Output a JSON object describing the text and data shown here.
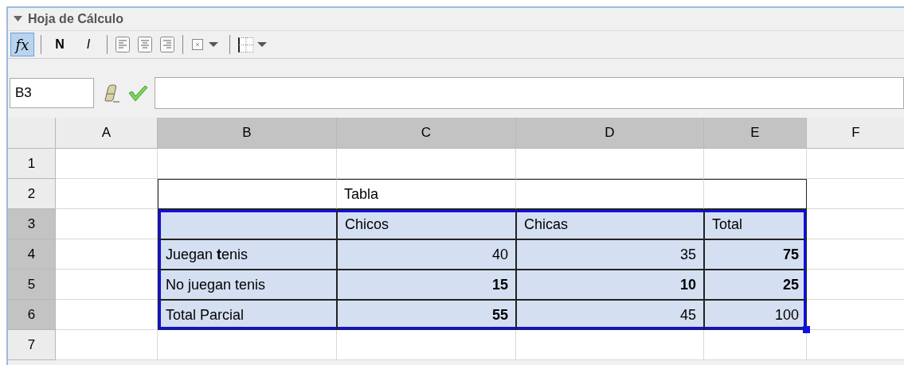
{
  "panel": {
    "title": "Hoja de Cálculo"
  },
  "toolbar": [
    {
      "kind": "formula",
      "label": "fx",
      "selected": true
    },
    {
      "kind": "sep"
    },
    {
      "kind": "bold",
      "label": "N",
      "selected": false
    },
    {
      "kind": "italic",
      "label": "I",
      "selected": false
    },
    {
      "kind": "sep"
    },
    {
      "kind": "align-left",
      "selected": false
    },
    {
      "kind": "align-center",
      "selected": false
    },
    {
      "kind": "align-right",
      "selected": false
    },
    {
      "kind": "sep"
    },
    {
      "kind": "border-menu"
    },
    {
      "kind": "sep"
    },
    {
      "kind": "grid-menu"
    }
  ],
  "formula_bar": {
    "cell_name": "B3"
  },
  "columns": [
    {
      "label": "A",
      "selected": false
    },
    {
      "label": "B",
      "selected": true
    },
    {
      "label": "C",
      "selected": true
    },
    {
      "label": "D",
      "selected": true
    },
    {
      "label": "E",
      "selected": true
    },
    {
      "label": "F",
      "selected": false
    }
  ],
  "rows": [
    {
      "label": "1",
      "selected": false,
      "cells": [
        {
          "selected": false,
          "outlined": false,
          "boxed": false
        },
        {
          "selected": false,
          "outlined": false,
          "boxed": false
        },
        {
          "selected": false,
          "outlined": false,
          "boxed": false
        },
        {
          "selected": false,
          "outlined": false,
          "boxed": false
        },
        {
          "selected": false,
          "outlined": false,
          "boxed": false
        },
        {
          "selected": false,
          "outlined": false,
          "boxed": false
        }
      ]
    },
    {
      "label": "2",
      "selected": false,
      "cells": [
        {
          "selected": false,
          "outlined": false,
          "boxed": false
        },
        {
          "selected": false,
          "outlined": true,
          "boxed": false
        },
        {
          "text": "Tabla",
          "bold": false,
          "numeric": false,
          "selected": false,
          "outlined": true,
          "boxed": false
        },
        {
          "selected": false,
          "outlined": true,
          "boxed": false
        },
        {
          "selected": false,
          "outlined": true,
          "boxed": false
        },
        {
          "selected": false,
          "outlined": false,
          "boxed": false
        }
      ]
    },
    {
      "label": "3",
      "selected": true,
      "cells": [
        {
          "selected": false,
          "outlined": false,
          "boxed": false
        },
        {
          "selected": true,
          "outlined": false,
          "boxed": true
        },
        {
          "text": "Chicos",
          "bold": false,
          "numeric": false,
          "selected": true,
          "outlined": false,
          "boxed": true
        },
        {
          "text": "Chicas",
          "bold": false,
          "numeric": false,
          "selected": true,
          "outlined": false,
          "boxed": true
        },
        {
          "text": "Total",
          "bold": false,
          "numeric": false,
          "selected": true,
          "outlined": false,
          "boxed": true
        },
        {
          "selected": false,
          "outlined": false,
          "boxed": false
        }
      ]
    },
    {
      "label": "4",
      "selected": true,
      "cells": [
        {
          "selected": false,
          "outlined": false,
          "boxed": false
        },
        {
          "text": "Juegan **t**enis",
          "bold": false,
          "numeric": false,
          "selected": true,
          "outlined": false,
          "boxed": true
        },
        {
          "text": "40",
          "bold": false,
          "numeric": true,
          "selected": true,
          "outlined": false,
          "boxed": true
        },
        {
          "text": "35",
          "bold": false,
          "numeric": true,
          "selected": true,
          "outlined": false,
          "boxed": true
        },
        {
          "text": "75",
          "bold": true,
          "numeric": true,
          "selected": true,
          "outlined": false,
          "boxed": true
        },
        {
          "selected": false,
          "outlined": false,
          "boxed": false
        }
      ]
    },
    {
      "label": "5",
      "selected": true,
      "cells": [
        {
          "selected": false,
          "outlined": false,
          "boxed": false
        },
        {
          "text": "No juegan tenis",
          "bold": false,
          "numeric": false,
          "selected": true,
          "outlined": false,
          "boxed": true
        },
        {
          "text": "15",
          "bold": true,
          "numeric": true,
          "selected": true,
          "outlined": false,
          "boxed": true
        },
        {
          "text": "10",
          "bold": true,
          "numeric": true,
          "selected": true,
          "outlined": false,
          "boxed": true
        },
        {
          "text": "25",
          "bold": true,
          "numeric": true,
          "selected": true,
          "outlined": false,
          "boxed": true
        },
        {
          "selected": false,
          "outlined": false,
          "boxed": false
        }
      ]
    },
    {
      "label": "6",
      "selected": true,
      "cells": [
        {
          "selected": false,
          "outlined": false,
          "boxed": false
        },
        {
          "text": "Total Parcial",
          "bold": false,
          "numeric": false,
          "selected": true,
          "outlined": false,
          "boxed": true
        },
        {
          "text": "55",
          "bold": true,
          "numeric": true,
          "selected": true,
          "outlined": false,
          "boxed": true
        },
        {
          "text": "45",
          "bold": false,
          "numeric": true,
          "selected": true,
          "outlined": false,
          "boxed": true
        },
        {
          "text": "100",
          "bold": false,
          "numeric": true,
          "selected": true,
          "outlined": false,
          "boxed": true
        },
        {
          "selected": false,
          "outlined": false,
          "boxed": false
        }
      ]
    },
    {
      "label": "7",
      "selected": false,
      "cells": [
        {
          "selected": false,
          "outlined": false,
          "boxed": false
        },
        {
          "selected": false,
          "outlined": false,
          "boxed": false
        },
        {
          "selected": false,
          "outlined": false,
          "boxed": false
        },
        {
          "selected": false,
          "outlined": false,
          "boxed": false
        },
        {
          "selected": false,
          "outlined": false,
          "boxed": false
        },
        {
          "selected": false,
          "outlined": false,
          "boxed": false
        }
      ]
    }
  ]
}
